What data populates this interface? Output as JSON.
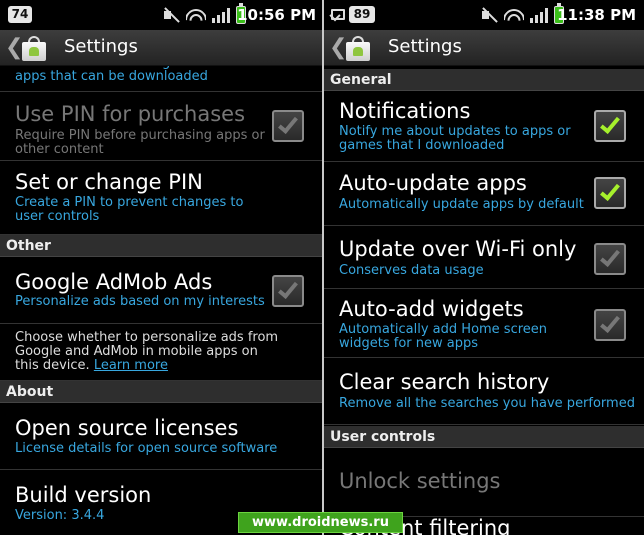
{
  "left": {
    "status": {
      "badge": "74",
      "time": "10:56 PM"
    },
    "actionbar": {
      "back": "❮",
      "title": "Settings"
    },
    "top_cut_text": "Set the content filtering level to restrict apps that can be downloaded",
    "use_pin": {
      "title": "Use PIN for purchases",
      "sub": "Require PIN before purchasing apps or other content",
      "checked": false,
      "enabled": false
    },
    "set_pin": {
      "title": "Set or change PIN",
      "sub": "Create a PIN to prevent changes to user controls"
    },
    "other_header": "Other",
    "admob": {
      "title": "Google AdMob Ads",
      "sub": "Personalize ads based on my interests",
      "checked": false
    },
    "admob_note": {
      "text": "Choose whether to personalize ads from Google and AdMob in mobile apps on this device.",
      "link": "Learn more"
    },
    "about_header": "About",
    "licenses": {
      "title": "Open source licenses",
      "sub": "License details for open source software"
    },
    "build": {
      "title": "Build version",
      "sub": "Version: 3.4.4"
    }
  },
  "right": {
    "status": {
      "badge": "89",
      "time": "11:38 PM"
    },
    "actionbar": {
      "back": "❮",
      "title": "Settings"
    },
    "general_header": "General",
    "notifications": {
      "title": "Notifications",
      "sub": "Notify me about updates to apps or games that I downloaded",
      "checked": true
    },
    "auto_update": {
      "title": "Auto-update apps",
      "sub": "Automatically update apps by default",
      "checked": true
    },
    "wifi_only": {
      "title": "Update over Wi-Fi only",
      "sub": "Conserves data usage",
      "checked": false
    },
    "auto_widgets": {
      "title": "Auto-add widgets",
      "sub": "Automatically add Home screen widgets for new apps",
      "checked": false
    },
    "clear_history": {
      "title": "Clear search history",
      "sub": "Remove all the searches you have performed"
    },
    "user_controls_header": "User controls",
    "unlock": {
      "title": "Unlock settings"
    },
    "content_filtering": {
      "title": "Content filtering"
    }
  },
  "watermark": "www.droidnews.ru",
  "colors": {
    "accent": "#38a7df",
    "check_on": "#a6f02c",
    "watermark_bg": "#3fa31d"
  }
}
